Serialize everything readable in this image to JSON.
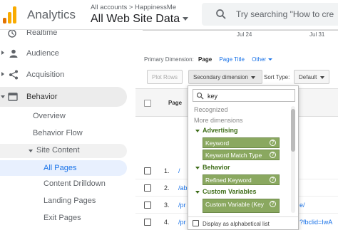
{
  "header": {
    "app_title": "Analytics",
    "accounts_crumb": "All accounts > HappinessMe",
    "account_name": "All Web Site Data",
    "search_placeholder": "Try searching \"How to cre"
  },
  "sidebar": {
    "items": [
      {
        "label": "Realtime",
        "icon": "clock-icon"
      },
      {
        "label": "Audience",
        "icon": "person-icon"
      },
      {
        "label": "Acquisition",
        "icon": "acquisition-icon"
      },
      {
        "label": "Behavior",
        "icon": "behavior-icon"
      },
      {
        "label": "Overview"
      },
      {
        "label": "Behavior Flow"
      },
      {
        "label": "Site Content"
      },
      {
        "label": "All Pages"
      },
      {
        "label": "Content Drilldown"
      },
      {
        "label": "Landing Pages"
      },
      {
        "label": "Exit Pages"
      }
    ]
  },
  "main": {
    "dates": [
      "Jul 24",
      "Jul 31"
    ],
    "primary_dimension_label": "Primary Dimension:",
    "primary_dims": [
      "Page",
      "Page Title",
      "Other"
    ],
    "plot_rows": "Plot Rows",
    "secondary_dimension": "Secondary dimension",
    "sort_type_label": "Sort Type:",
    "sort_type_value": "Default",
    "column_page": "Page",
    "rows": [
      {
        "num": "1.",
        "path": "/"
      },
      {
        "num": "2.",
        "path": "/ab"
      },
      {
        "num": "3.",
        "path": "/pr"
      },
      {
        "num": "4.",
        "path": "/pr"
      },
      {
        "num": "5.",
        "path": "/pr"
      }
    ],
    "row_tails": [
      "e/",
      "?fbclid=IwA"
    ]
  },
  "dropdown": {
    "search_value": "key",
    "recognized_label": "Recognized",
    "more_dimensions_label": "More dimensions",
    "groups": [
      {
        "name": "Advertising",
        "items": [
          "Keyword",
          "Keyword Match Type"
        ]
      },
      {
        "name": "Behavior",
        "items": [
          "Refined Keyword"
        ]
      },
      {
        "name": "Custom Variables",
        "items": [
          "Custom Variable (Key"
        ]
      }
    ],
    "alpha_label": "Display as alphabetical list"
  }
}
